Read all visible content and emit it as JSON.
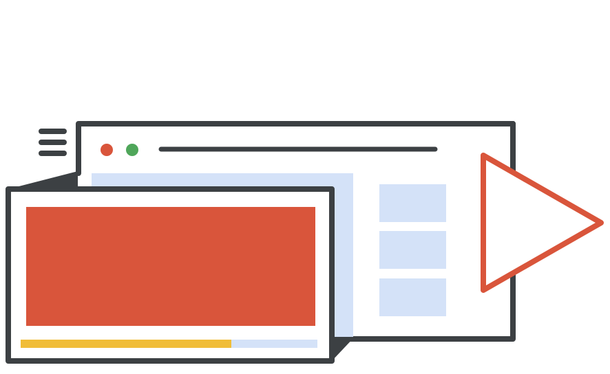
{
  "colors": {
    "outline": "#3c4043",
    "red": "#d9553b",
    "green": "#4fa65a",
    "light_blue": "#d4e2f8",
    "yellow": "#f0bd38",
    "background": "#ffffff"
  },
  "icons": {
    "menu": "hamburger-menu-icon",
    "play": "play-icon",
    "window_dots": [
      "red-dot",
      "green-dot"
    ]
  },
  "video_progress": {
    "fraction": 0.71
  },
  "sidebar_cards": {
    "count": 3
  }
}
